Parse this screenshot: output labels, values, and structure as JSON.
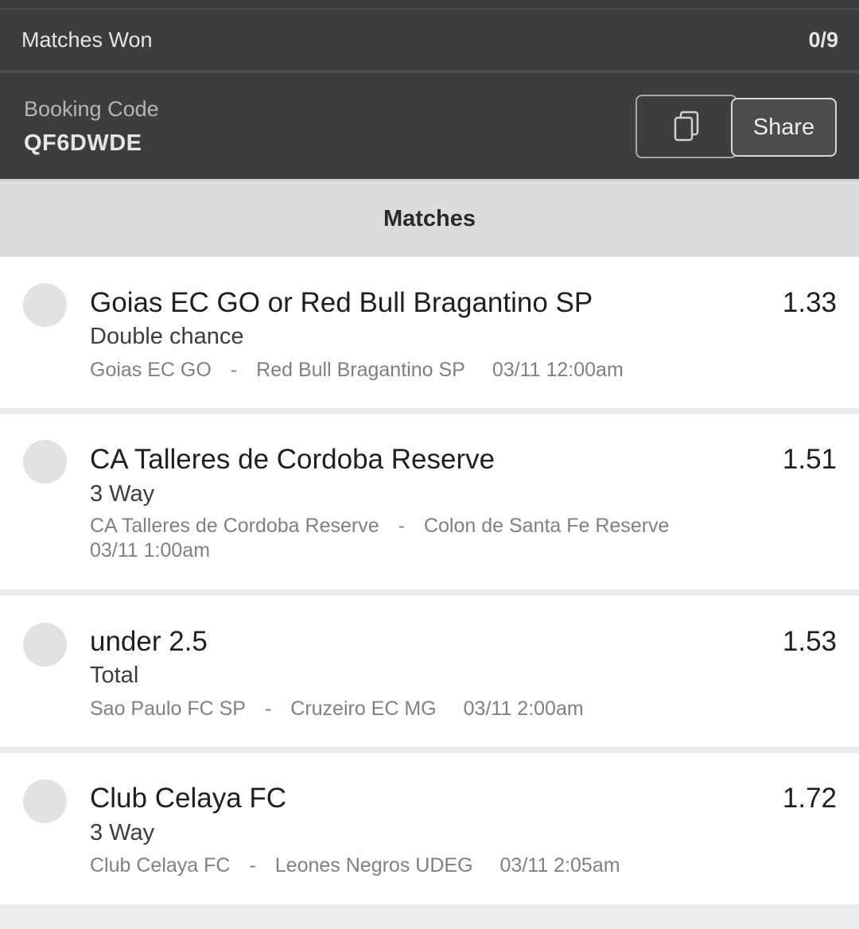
{
  "summary": {
    "matches_won_label": "Matches Won",
    "matches_won_value": "0/9"
  },
  "booking": {
    "label": "Booking Code",
    "code": "QF6DWDE",
    "copy_icon": "copy-icon",
    "share_label": "Share"
  },
  "section": {
    "title": "Matches"
  },
  "matches": [
    {
      "selection": "Goias EC GO or Red Bull Bragantino SP",
      "odds": "1.33",
      "market": "Double chance",
      "home": "Goias EC GO",
      "separator": "-",
      "away": "Red Bull Bragantino SP",
      "time": "03/11 12:00am"
    },
    {
      "selection": "CA Talleres de Cordoba Reserve",
      "odds": "1.51",
      "market": "3 Way",
      "home": "CA Talleres de Cordoba Reserve",
      "separator": "-",
      "away": "Colon de Santa Fe Reserve",
      "time": "03/11 1:00am"
    },
    {
      "selection": "under 2.5",
      "odds": "1.53",
      "market": "Total",
      "home": "Sao Paulo FC SP",
      "separator": "-",
      "away": "Cruzeiro EC MG",
      "time": "03/11 2:00am"
    },
    {
      "selection": "Club Celaya FC",
      "odds": "1.72",
      "market": "3 Way",
      "home": "Club Celaya FC",
      "separator": "-",
      "away": "Leones Negros UDEG",
      "time": "03/11 2:05am"
    }
  ]
}
